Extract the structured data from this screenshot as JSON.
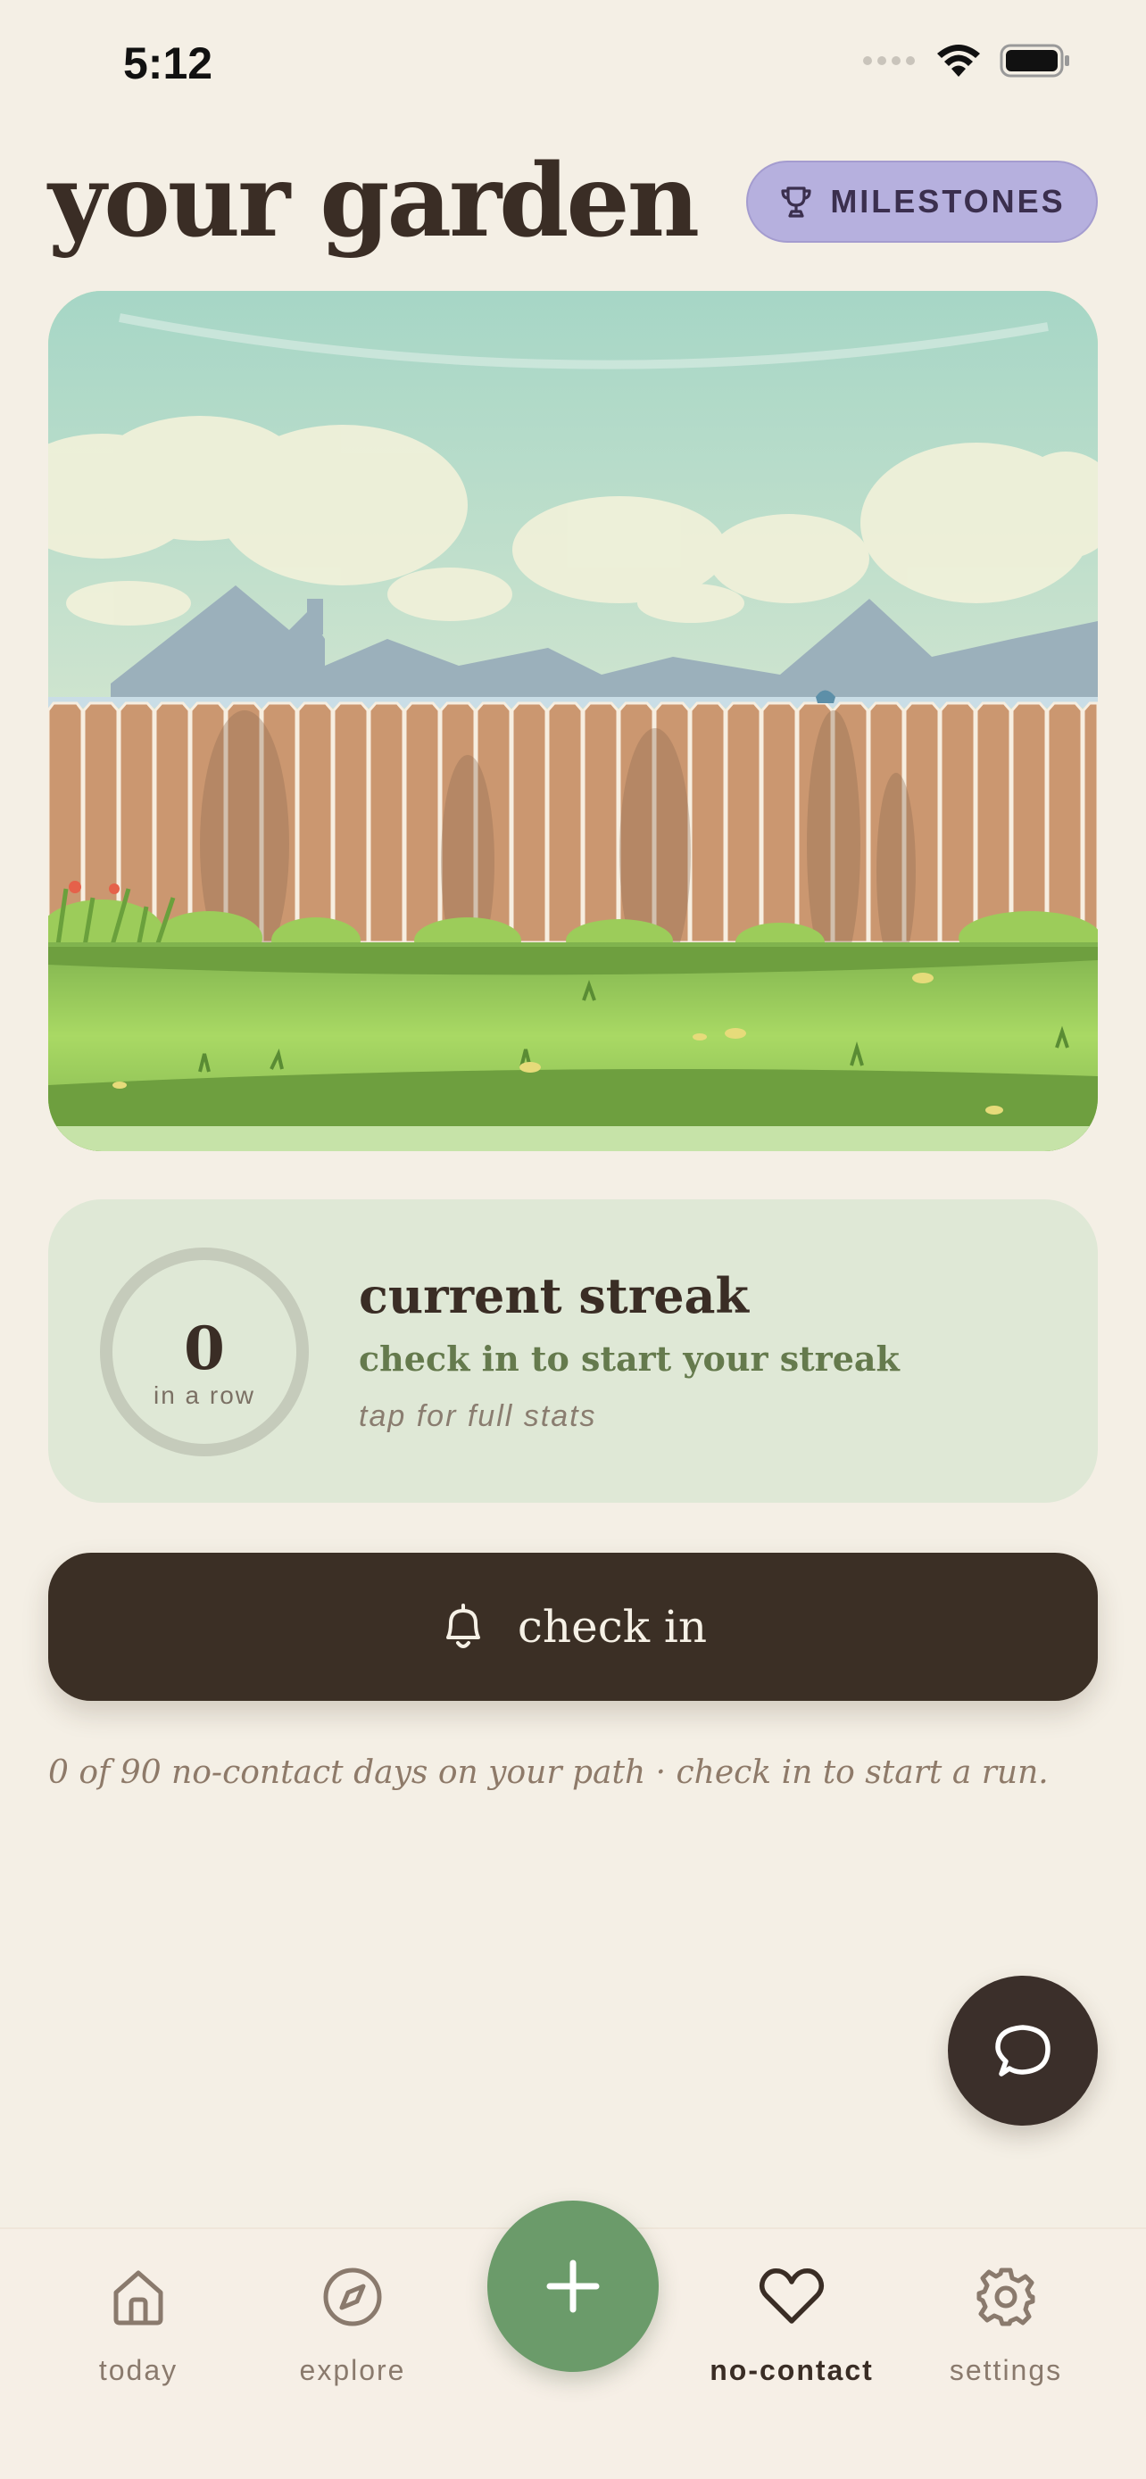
{
  "status_bar": {
    "time": "5:12"
  },
  "header": {
    "title": "your garden",
    "milestones_label": "MILESTONES"
  },
  "streak": {
    "count": "0",
    "unit": "in a row",
    "title": "current streak",
    "subtitle": "check in to start your streak",
    "hint": "tap for full stats"
  },
  "checkin": {
    "label": "check in"
  },
  "path_note": "0 of 90 no-contact days on your path · check in to start a run.",
  "tabs": [
    {
      "label": "today",
      "icon": "home-icon"
    },
    {
      "label": "explore",
      "icon": "compass-icon"
    },
    {
      "label": "no-contact",
      "icon": "heart-icon",
      "active": true
    },
    {
      "label": "settings",
      "icon": "gear-icon"
    }
  ],
  "colors": {
    "background": "#f4efe5",
    "accent_green": "#6b9b6a",
    "dark": "#3b2f25",
    "milestone": "#b6b0de"
  }
}
